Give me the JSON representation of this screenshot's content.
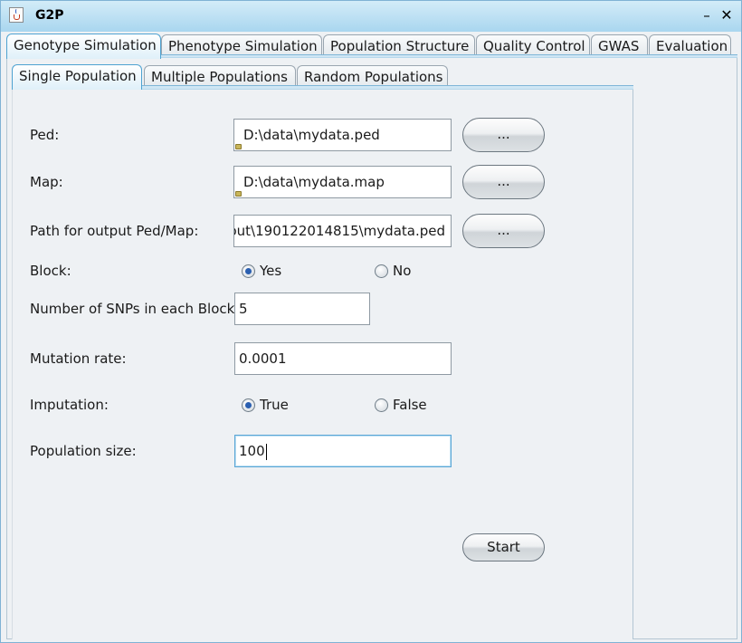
{
  "window": {
    "title": "G2P",
    "minimize_glyph": "–",
    "close_glyph": "✕"
  },
  "main_tabs": [
    {
      "label": "Genotype Simulation",
      "active": true
    },
    {
      "label": "Phenotype Simulation",
      "active": false
    },
    {
      "label": "Population Structure",
      "active": false
    },
    {
      "label": "Quality Control",
      "active": false
    },
    {
      "label": "GWAS",
      "active": false
    },
    {
      "label": "Evaluation",
      "active": false
    }
  ],
  "sub_tabs": [
    {
      "label": "Single Population",
      "active": true
    },
    {
      "label": "Multiple Populations",
      "active": false
    },
    {
      "label": "Random Populations",
      "active": false
    }
  ],
  "form": {
    "ped": {
      "label": "Ped:",
      "value": "D:\\data\\mydata.ped",
      "browse_label": "..."
    },
    "map": {
      "label": "Map:",
      "value": "D:\\data\\mydata.map",
      "browse_label": "..."
    },
    "output": {
      "label": "Path for output Ped/Map:",
      "value": "out\\190122014815\\mydata.ped",
      "browse_label": "..."
    },
    "block": {
      "label": "Block:",
      "options": [
        {
          "label": "Yes",
          "checked": true
        },
        {
          "label": "No",
          "checked": false
        }
      ]
    },
    "snps_per_block": {
      "label": "Number of SNPs in each Block:",
      "value": "5"
    },
    "mutation_rate": {
      "label": "Mutation rate:",
      "value": "0.0001"
    },
    "imputation": {
      "label": "Imputation:",
      "options": [
        {
          "label": "True",
          "checked": true
        },
        {
          "label": "False",
          "checked": false
        }
      ]
    },
    "population_size": {
      "label": "Population size:",
      "value": "100"
    }
  },
  "start_label": "Start",
  "colors": {
    "titlebar": "#a9d6ef",
    "panel": "#eef1f4",
    "tab_accent": "#4ea2d1",
    "radio_dot": "#2a5fb0"
  }
}
